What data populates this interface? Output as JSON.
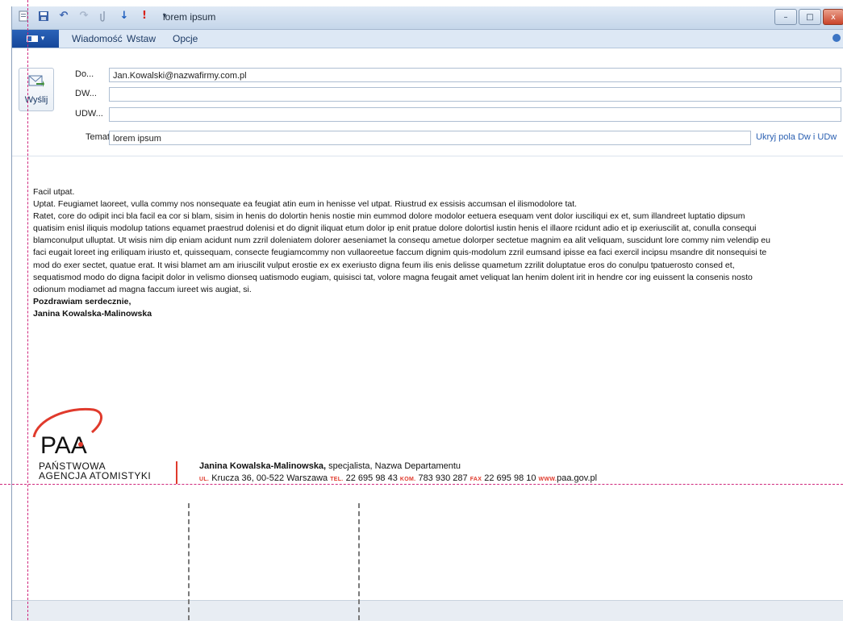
{
  "window": {
    "title": "lorem ipsum",
    "controls": {
      "minimize": "–",
      "maximize": "□",
      "close": "x"
    }
  },
  "quick_access": {
    "icons": [
      "page-icon",
      "save-icon",
      "undo-icon",
      "redo-icon",
      "attach-icon",
      "priority-low-icon",
      "priority-high-icon",
      "customize-icon"
    ]
  },
  "ribbon": {
    "tabs": [
      "Wiadomość",
      "Wstaw",
      "Opcje"
    ]
  },
  "compose": {
    "send_label": "Wyślij",
    "to_label": "Do...",
    "to_value": "Jan.Kowalski@nazwafirmy.com.pl",
    "cc_label": "DW...",
    "cc_value": "",
    "bcc_label": "UDW...",
    "bcc_value": "",
    "subject_label": "Temat",
    "subject_value": "lorem ipsum",
    "hide_link": "Ukryj pola Dw i UDw"
  },
  "message": {
    "greeting": "Facil utpat.",
    "para1": "Uptat. Feugiamet laoreet, vulla commy nos nonsequate ea feugiat atin eum in henisse vel utpat. Riustrud ex essisis accumsan el ilismodolore tat.",
    "para2": "Ratet, core do odipit inci bla facil ea cor si blam, sisim in henis do dolortin henis nostie min eummod dolore modolor eetuera esequam vent dolor iusciliqui ex et, sum illandreet luptatio dipsum quatisim enisl iliquis modolup tations equamet praestrud dolenisi et do dignit iliquat etum dolor ip enit pratue dolore dolortisl iustin henis el illaore rcidunt adio et ip exeriuscilit at, conulla consequi blamconulput ulluptat. Ut wisis nim dip eniam acidunt num zzril doleniatem dolorer aeseniamet la consequ ametue dolorper sectetue magnim ea alit veliquam, suscidunt lore commy nim velendip eu faci eugait loreet ing eriliquam iriusto et, quissequam, consecte feugiamcommy non vullaoreetue faccum dignim quis-modolum zzril eumsand ipisse ea faci exercil incipsu msandre dit nonsequisi te mod do exer sectet, quatue erat. It wisi blamet am am iriuscilit vulput erostie ex ex exeriusto digna feum ilis enis delisse quametum zzrilit doluptatue eros do conulpu tpatuerosto consed et, sequatismod modo do digna facipit dolor in velismo dionseq uatismodo eugiam, quisisci tat, volore magna feugait amet veliquat lan henim dolent irit in hendre cor ing euissent la consenis nosto odionum modiamet ad magna faccum iureet wis augiat, si.",
    "closing": "Pozdrawiam serdecznie,",
    "signer": "Janina Kowalska-Malinowska"
  },
  "signature": {
    "logo_text": "PAA",
    "org_line1": "PAŃSTWOWA",
    "org_line2": "AGENCJA ATOMISTYKI",
    "name": "Janina Kowalska-Malinowska,",
    "role": " specjalista, Nazwa Departamentu",
    "addr_key": "UL.",
    "addr": " Krucza 36, 00-522 Warszawa ",
    "tel_key": "TEL.",
    "tel": " 22 695 98 43 ",
    "kom_key": "KOM.",
    "kom": " 783 930 287 ",
    "fax_key": "FAX",
    "fax": " 22 695 98 10 ",
    "www_key": "WWW.",
    "www": "paa.gov.pl"
  },
  "colors": {
    "accent_red": "#e03a2c",
    "link_blue": "#2a5fb1",
    "file_tab": "#1f56a8",
    "guide_magenta": "#d0277d"
  }
}
